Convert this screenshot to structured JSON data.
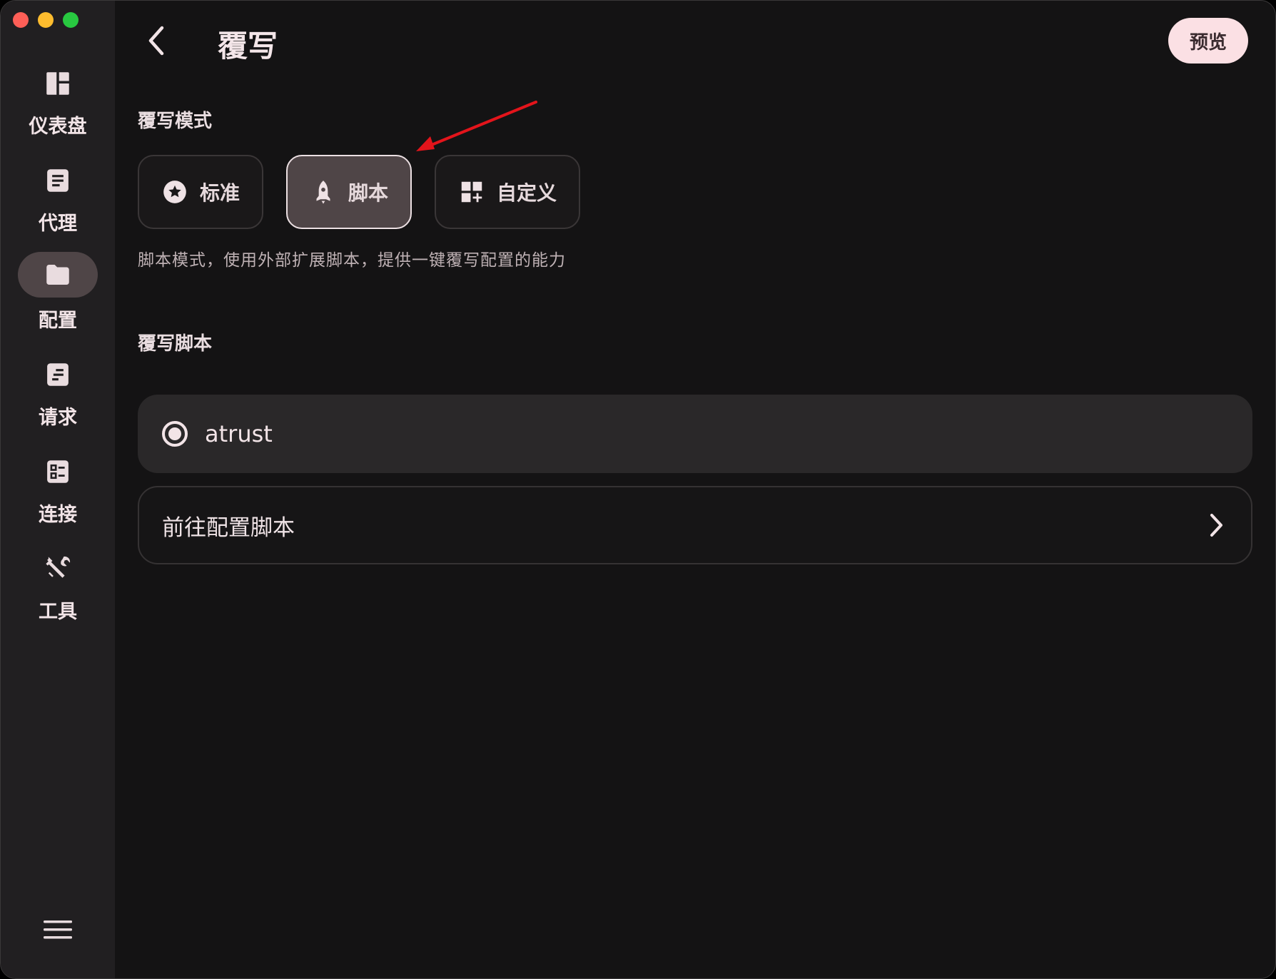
{
  "sidebar": {
    "items": [
      {
        "label": "仪表盘",
        "icon": "dashboard-icon"
      },
      {
        "label": "代理",
        "icon": "proxy-icon"
      },
      {
        "label": "配置",
        "icon": "folder-icon",
        "active": true
      },
      {
        "label": "请求",
        "icon": "requests-icon"
      },
      {
        "label": "连接",
        "icon": "connections-icon"
      },
      {
        "label": "工具",
        "icon": "tools-icon"
      }
    ]
  },
  "header": {
    "title": "覆写",
    "preview_label": "预览"
  },
  "mode_section": {
    "title": "覆写模式",
    "modes": [
      {
        "label": "标准",
        "icon": "star-circle-icon"
      },
      {
        "label": "脚本",
        "icon": "rocket-icon",
        "selected": true
      },
      {
        "label": "自定义",
        "icon": "widgets-add-icon"
      }
    ],
    "description": "脚本模式，使用外部扩展脚本，提供一键覆写配置的能力"
  },
  "script_section": {
    "title": "覆写脚本",
    "scripts": [
      {
        "name": "atrust",
        "selected": true
      }
    ],
    "goto_label": "前往配置脚本"
  },
  "colors": {
    "background": "#141314",
    "sidebar": "#211f21",
    "accent_selected": "#4f4547",
    "preview_button": "#fbe0e4",
    "annotation_arrow": "#e3141b"
  }
}
